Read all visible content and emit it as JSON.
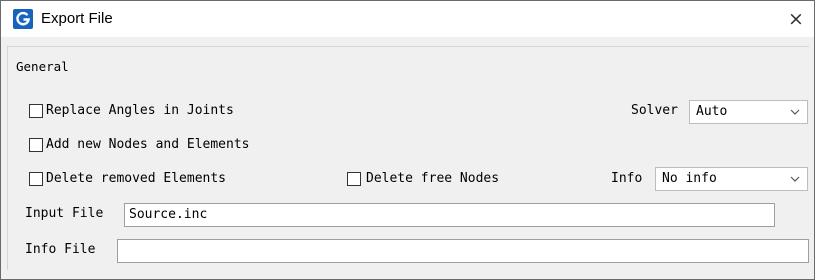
{
  "window": {
    "title": "Export File",
    "close_glyph": "×",
    "app_icon": "g-logo-icon",
    "accent_color": "#1565c0"
  },
  "general": {
    "group_label": "General",
    "replace_angles": {
      "label": "Replace Angles in Joints",
      "checked": false
    },
    "add_nodes": {
      "label": "Add new Nodes and Elements",
      "checked": false
    },
    "delete_removed": {
      "label": "Delete removed Elements",
      "checked": false
    },
    "delete_free": {
      "label": "Delete free Nodes",
      "checked": false
    },
    "solver": {
      "label": "Solver",
      "value": "Auto"
    },
    "info": {
      "label": "Info",
      "value": "No info"
    },
    "input_file": {
      "label": "Input File",
      "value": "Source.inc"
    },
    "info_file": {
      "label": "Info File",
      "value": ""
    }
  }
}
